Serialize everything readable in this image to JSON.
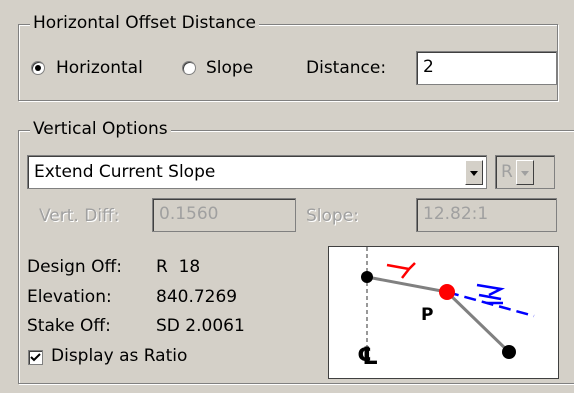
{
  "horizontal_group": {
    "title": "Horizontal Offset Distance",
    "radio_horizontal": "Horizontal",
    "radio_slope": "Slope",
    "selected": "Horizontal",
    "distance_label": "Distance:",
    "distance_value": "2"
  },
  "vertical_group": {
    "title": "Vertical Options",
    "method_select": "Extend Current Slope",
    "side_select": "R",
    "vert_diff_label": "Vert. Diff:",
    "vert_diff_value": "0.1560",
    "slope_label": "Slope:",
    "slope_value": "12.82:1",
    "design_off_label": "Design Off:",
    "design_off_value": "R  18",
    "elevation_label": "Elevation:",
    "elevation_value": "840.7269",
    "stake_off_label": "Stake Off:",
    "stake_off_value": "SD 2.0061",
    "display_ratio_label": "Display as Ratio",
    "display_ratio_checked": true
  },
  "diagram": {
    "point_label": "P",
    "centerline_symbol": "℄",
    "colors": {
      "red": "#ff0000",
      "blue": "#0000ff",
      "gray": "#808080"
    }
  }
}
